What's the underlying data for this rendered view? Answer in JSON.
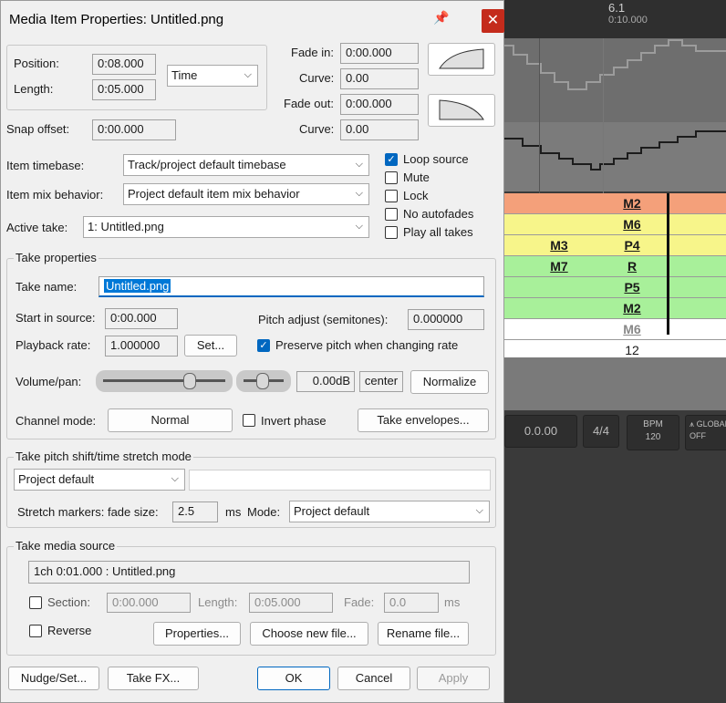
{
  "window": {
    "title": "Media Item Properties:  Untitled.png"
  },
  "position": {
    "label": "Position:",
    "value": "0:08.000"
  },
  "length": {
    "label": "Length:",
    "value": "0:05.000"
  },
  "time_mode": "Time",
  "fade_in": {
    "label": "Fade in:",
    "value": "0:00.000",
    "curve_label": "Curve:",
    "curve_value": "0.00"
  },
  "fade_out": {
    "label": "Fade out:",
    "value": "0:00.000",
    "curve_label": "Curve:",
    "curve_value": "0.00"
  },
  "snap_offset": {
    "label": "Snap offset:",
    "value": "0:00.000"
  },
  "item_timebase": {
    "label": "Item timebase:",
    "value": "Track/project default timebase"
  },
  "item_mix": {
    "label": "Item mix behavior:",
    "value": "Project default item mix behavior"
  },
  "active_take": {
    "label": "Active take:",
    "value": "1: Untitled.png"
  },
  "options": {
    "loop_source": {
      "label": "Loop source",
      "checked": true
    },
    "mute": {
      "label": "Mute",
      "checked": false
    },
    "lock": {
      "label": "Lock",
      "checked": false
    },
    "no_autofades": {
      "label": "No autofades",
      "checked": false
    },
    "play_all_takes": {
      "label": "Play all takes",
      "checked": false
    }
  },
  "take_properties": {
    "title": "Take properties",
    "take_name_label": "Take name:",
    "take_name": "Untitled.png",
    "start_label": "Start in source:",
    "start_value": "0:00.000",
    "pitch_label": "Pitch adjust (semitones):",
    "pitch_value": "0.000000",
    "rate_label": "Playback rate:",
    "rate_value": "1.000000",
    "set_button": "Set...",
    "preserve_pitch": {
      "label": "Preserve pitch when changing rate",
      "checked": true
    },
    "volpan_label": "Volume/pan:",
    "volume_value": "0.00dB",
    "pan_value": "center",
    "normalize": "Normalize",
    "channel_label": "Channel mode:",
    "channel_value": "Normal",
    "invert_phase": {
      "label": "Invert phase",
      "checked": false
    },
    "take_envelopes": "Take envelopes..."
  },
  "pitch_shift": {
    "title": "Take pitch shift/time stretch mode",
    "mode_value": "Project default",
    "stretch_label": "Stretch markers: fade size:",
    "fade_size": "2.5",
    "unit": "ms",
    "mode_label": "Mode:",
    "mode2_value": "Project default"
  },
  "media_source": {
    "title": "Take media source",
    "source": "1ch 0:01.000 : Untitled.png",
    "section": {
      "label": "Section:",
      "checked": false
    },
    "section_start": "0:00.000",
    "length_label": "Length:",
    "length_value": "0:05.000",
    "fade_label": "Fade:",
    "fade_value": "0.0",
    "unit": "ms",
    "reverse": {
      "label": "Reverse",
      "checked": false
    },
    "properties_button": "Properties...",
    "choose_button": "Choose new file...",
    "rename_button": "Rename file..."
  },
  "buttons": {
    "nudge": "Nudge/Set...",
    "take_fx": "Take FX...",
    "ok": "OK",
    "cancel": "Cancel",
    "apply": "Apply"
  },
  "background": {
    "ruler_top": "6.1",
    "ruler_sub": "0:10.000",
    "grid_rows": [
      {
        "color": "#f4a07a",
        "cells": [
          "",
          "M2"
        ]
      },
      {
        "color": "#f7f58a",
        "cells": [
          "",
          "M6"
        ]
      },
      {
        "color": "#f7f58a",
        "cells": [
          "M3",
          "P4"
        ]
      },
      {
        "color": "#a8f09a",
        "cells": [
          "M7",
          "R"
        ]
      },
      {
        "color": "#a8f09a",
        "cells": [
          "",
          "P5"
        ]
      },
      {
        "color": "#a8f09a",
        "cells": [
          "",
          "M2"
        ]
      },
      {
        "color": "#ffffff",
        "cells": [
          "",
          "M6"
        ]
      }
    ],
    "bar_number": "12",
    "transport_time": "0.0.00",
    "time_sig": "4/4",
    "bpm_label": "BPM",
    "bpm_value": "120",
    "global_label": "GLOBAL",
    "global_state": "OFF"
  }
}
